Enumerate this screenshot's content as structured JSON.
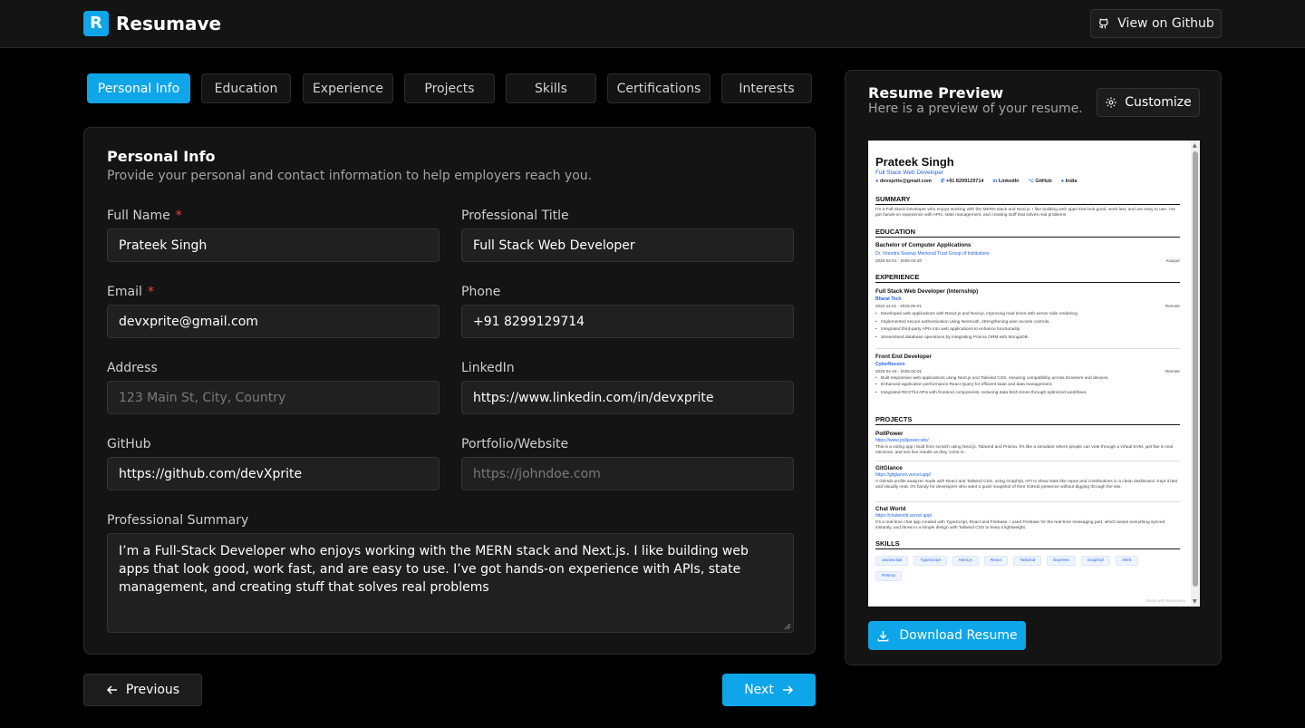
{
  "header": {
    "logo_letter": "R",
    "brand": "Resumave",
    "github_button": "View on Github"
  },
  "tabs": [
    {
      "label": "Personal Info",
      "active": true
    },
    {
      "label": "Education"
    },
    {
      "label": "Experience"
    },
    {
      "label": "Projects"
    },
    {
      "label": "Skills"
    },
    {
      "label": "Certifications"
    },
    {
      "label": "Interests"
    }
  ],
  "form": {
    "title": "Personal Info",
    "subtitle": "Provide your personal and contact information to help employers reach you.",
    "fields": {
      "full_name": {
        "label": "Full Name",
        "value": "Prateek Singh"
      },
      "professional_title": {
        "label": "Professional Title",
        "value": "Full Stack Web Developer"
      },
      "email": {
        "label": "Email",
        "value": "devxprite@gmail.com"
      },
      "phone": {
        "label": "Phone",
        "value": "+91 8299129714"
      },
      "address": {
        "label": "Address",
        "placeholder": "123 Main St, City, Country"
      },
      "linkedin": {
        "label": "LinkedIn",
        "value": "https://www.linkedin.com/in/devxprite"
      },
      "github": {
        "label": "GitHub",
        "value": "https://github.com/devXprite"
      },
      "portfolio": {
        "label": "Portfolio/Website",
        "placeholder": "https://johndoe.com"
      },
      "summary": {
        "label": "Professional Summary",
        "value": "I’m a Full-Stack Developer who enjoys working with the MERN stack and Next.js. I like building web apps that look good, work fast, and are easy to use. I’ve got hands-on experience with APIs, state management, and creating stuff that solves real problems"
      }
    },
    "required_mark": "*"
  },
  "nav": {
    "previous": "Previous",
    "next": "Next"
  },
  "preview": {
    "title": "Resume Preview",
    "subtitle": "Here is a preview of your resume.",
    "customize": "Customize",
    "download": "Download Resume",
    "resume": {
      "name": "Prateek Singh",
      "role": "Full Stack Web Developer",
      "contact": {
        "email": "devxprite@gmail.com",
        "phone": "+91 8299129714",
        "linkedin": "LinkedIn",
        "github": "GitHub",
        "location": "India"
      },
      "summary_heading": "SUMMARY",
      "summary": "I'm a Full-Stack Developer who enjoys working with the MERN stack and Next.js. I like building web apps that look good, work fast, and are easy to use. I've got hands-on experience with APIs, state management, and creating stuff that solves real problems",
      "education_heading": "EDUCATION",
      "education": {
        "degree": "Bachelor of Computer Applications",
        "school": "Dr. Virendra Swarup Memorial Trust Group of Institutions",
        "dates": "2025-04-01 - 2025-04-20",
        "location": "Kanpur"
      },
      "experience_heading": "EXPERIENCE",
      "experience": [
        {
          "title": "Full Stack Web Developer (Internship)",
          "company": "Bharat Tech",
          "dates": "2022-11-01 - 2023-05-01",
          "location": "Remote",
          "bullets": [
            "Developed web applications with React.js and Next.js, improving load times with server-side rendering.",
            "Implemented secure authentication using NextAuth, strengthening user access controls.",
            "Integrated third-party APIs into web applications to enhance functionality.",
            "Streamlined database operations by integrating Prisma ORM with MongoDB."
          ]
        },
        {
          "title": "Front End Developer",
          "company": "CyberReconn",
          "dates": "2025-04-16 - 2025-04-01",
          "location": "Remote",
          "bullets": [
            "Built responsive web applications using Next.js and Tailwind CSS, ensuring compatibility across browsers and devices.",
            "Enhanced application performance React Query for efficient state and data management.",
            "Integrated RESTful APIs with frontend components, reducing data fetch times through optimized workflows."
          ]
        }
      ],
      "projects_heading": "PROJECTS",
      "projects": [
        {
          "name": "PollPower",
          "url": "https://www.pollpower.site/",
          "desc": "This is a voting app I built from scratch using Next.js, Tailwind and Prisma. It's like a simulator where people can vote through a virtual EVM, just like in real elections, and see live results as they come in."
        },
        {
          "name": "GitGlance",
          "url": "https://gitglance.vercel.app/",
          "desc": "A GitHub profile analyzer made with React and Tailwind CSS, using GraphQL API to show stats like repos and contributions in a clean dashboard. Kept it fast and visually neat. It's handy for developers who want a quick snapshot of their GitHub presence without digging through the site."
        },
        {
          "name": "Chat World",
          "url": "https://chatworld.vercel.app/",
          "desc": "It's a real-time chat app created with TypeScript, React and Firebase. I used Firebase for the real-time messaging part, which keeps everything synced instantly, and threw in a simple design with Tailwind CSS to keep it lightweight."
        }
      ],
      "skills_heading": "SKILLS",
      "skills": [
        "JavaScript",
        "TypeScript",
        "Next.js",
        "React",
        "Tailwind",
        "Express",
        "GraphQl",
        "AWS",
        "Prisma"
      ],
      "footer": "Made with Resumave"
    }
  }
}
